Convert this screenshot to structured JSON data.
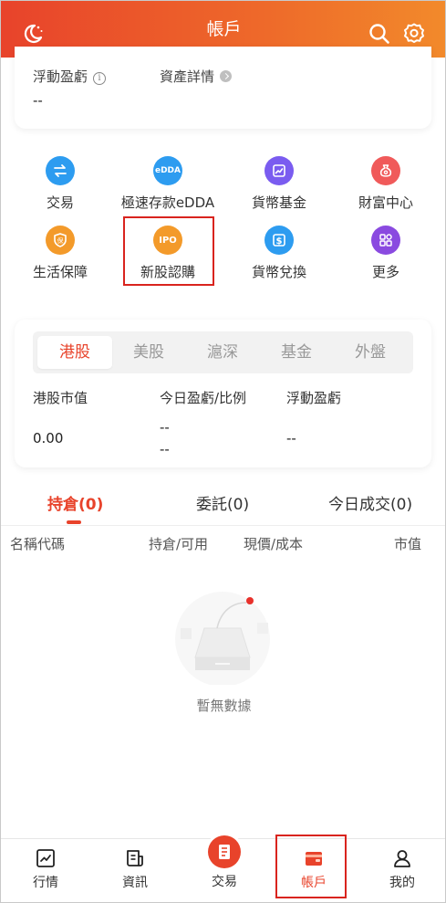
{
  "header": {
    "title": "帳戶"
  },
  "account_card": {
    "floating_pnl_label": "浮動盈虧",
    "asset_details_label": "資產詳情",
    "floating_pnl_value": "--"
  },
  "quick_menu": [
    {
      "label": "交易",
      "icon": "swap-icon",
      "color": "#2d9cf0"
    },
    {
      "label": "極速存款eDDA",
      "icon": "edda-icon",
      "color": "#2d9cf0"
    },
    {
      "label": "貨幣基金",
      "icon": "fund-chart-icon",
      "color": "#7a5cf0"
    },
    {
      "label": "財富中心",
      "icon": "money-bag-icon",
      "color": "#f05a5a"
    },
    {
      "label": "生活保障",
      "icon": "insurance-shield-icon",
      "color": "#f39a2a"
    },
    {
      "label": "新股認購",
      "icon": "ipo-icon",
      "color": "#f39a2a"
    },
    {
      "label": "貨幣兌換",
      "icon": "currency-exchange-icon",
      "color": "#2d9cf0"
    },
    {
      "label": "更多",
      "icon": "more-grid-icon",
      "color": "#8a4ae0"
    }
  ],
  "market_card": {
    "tabs": [
      "港股",
      "美股",
      "滬深",
      "基金",
      "外盤"
    ],
    "active_tab": "港股",
    "headers": [
      "港股市值",
      "今日盈虧/比例",
      "浮動盈虧"
    ],
    "market_value": "0.00",
    "today_pnl": "--",
    "today_pnl_ratio": "--",
    "floating_pnl": "--"
  },
  "position_tabs": [
    {
      "label": "持倉(0)",
      "active": true
    },
    {
      "label": "委託(0)",
      "active": false
    },
    {
      "label": "今日成交(0)",
      "active": false
    }
  ],
  "columns": [
    "名稱代碼",
    "持倉/可用",
    "現價/成本",
    "市值"
  ],
  "empty_text": "暫無數據",
  "bottom_nav": [
    {
      "label": "行情",
      "icon": "market-trend-icon"
    },
    {
      "label": "資訊",
      "icon": "news-icon"
    },
    {
      "label": "交易",
      "icon": "trade-icon"
    },
    {
      "label": "帳戶",
      "icon": "wallet-icon",
      "active": true
    },
    {
      "label": "我的",
      "icon": "profile-icon"
    }
  ],
  "colors": {
    "accent": "#e8432b",
    "highlight_box": "#d9241e"
  }
}
